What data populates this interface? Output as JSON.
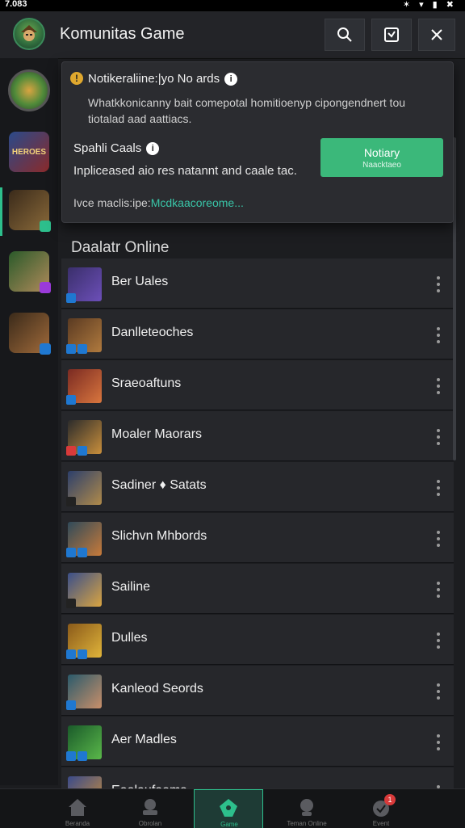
{
  "status_bar": {
    "time": "7.083",
    "icons": "✶ ▾ ▮ ✖"
  },
  "app_bar": {
    "title": "Komunitas Game",
    "icons": [
      "search-icon",
      "checkbox-icon",
      "close-icon"
    ]
  },
  "popup": {
    "title": "Notikeraliine:|yo No ards",
    "description": "Whatkkonicanny bait comepotal homitioenyp cipongendnert tou tiotalad aad aattiacs.",
    "sub_title": "Spahli Caals",
    "sub_description": "Inpliceased aio res natannt and caale tac.",
    "more_prefix": "Ivce maclis:ipe:",
    "more_link": "Mcdkaacoreome...",
    "notify_button": {
      "label": "Notiary",
      "sub_label": "Naacktaeo"
    }
  },
  "section": {
    "title": "Daalatr Online"
  },
  "games": [
    {
      "label": "Ber Uales",
      "colors": [
        "#3a2f6b",
        "#6c4fb8"
      ],
      "badge": "#1f78d1"
    },
    {
      "label": "Danlleteoches",
      "colors": [
        "#5a3a22",
        "#b07a3e"
      ],
      "badge": "#1f78d1"
    },
    {
      "label": "Sraeoaftuns",
      "colors": [
        "#7a2a22",
        "#d9763e"
      ],
      "badge": "#1f78d1"
    },
    {
      "label": "Moaler Maorars",
      "colors": [
        "#2b2b2b",
        "#c98f3c"
      ],
      "badge": "#d93a3a"
    },
    {
      "label": "Sadiner ♦ Satats",
      "colors": [
        "#2c3f6b",
        "#b08a4a"
      ],
      "badge": "#222222"
    },
    {
      "label": "Slichvn Mhbords",
      "colors": [
        "#2f4a5a",
        "#c77a3a"
      ],
      "badge": "#1f78d1"
    },
    {
      "label": "Sailine",
      "colors": [
        "#3a4f8a",
        "#d9a441"
      ],
      "badge": "#222222"
    },
    {
      "label": "Dulles",
      "colors": [
        "#8a5a1a",
        "#e0b43a"
      ],
      "badge": "#1f78d1"
    },
    {
      "label": "Kanleod Seords",
      "colors": [
        "#2a5a6b",
        "#c98f6a"
      ],
      "badge": "#1f78d1"
    },
    {
      "label": "Aer Madles",
      "colors": [
        "#1a5a2a",
        "#5ab84a"
      ],
      "badge": "#1f78d1"
    },
    {
      "label": "Eoalaufaems",
      "colors": [
        "#3a4a8a",
        "#c98f3c"
      ],
      "badge": "#1f78d1"
    }
  ],
  "sidebar": {
    "items": [
      {
        "name": "sidebar-game-logo",
        "text": ""
      },
      {
        "name": "sidebar-game-heroes",
        "text": "HEROES"
      },
      {
        "name": "sidebar-game-ranger",
        "text": ""
      },
      {
        "name": "sidebar-game-elf",
        "text": ""
      },
      {
        "name": "sidebar-game-warrior",
        "text": ""
      }
    ]
  },
  "bottom_nav": {
    "items": [
      {
        "label": "Beranda",
        "icon": "home-icon"
      },
      {
        "label": "Obrolan",
        "icon": "chat-icon"
      },
      {
        "label": "Game",
        "icon": "game-icon"
      },
      {
        "label": "Teman Online",
        "icon": "friends-icon"
      },
      {
        "label": "Event",
        "icon": "event-icon",
        "badge": "1"
      }
    ],
    "active_index": 2
  },
  "colors": {
    "accent": "#2dbf8c",
    "notify_button": "#3bb87a",
    "link": "#39c6a8"
  }
}
